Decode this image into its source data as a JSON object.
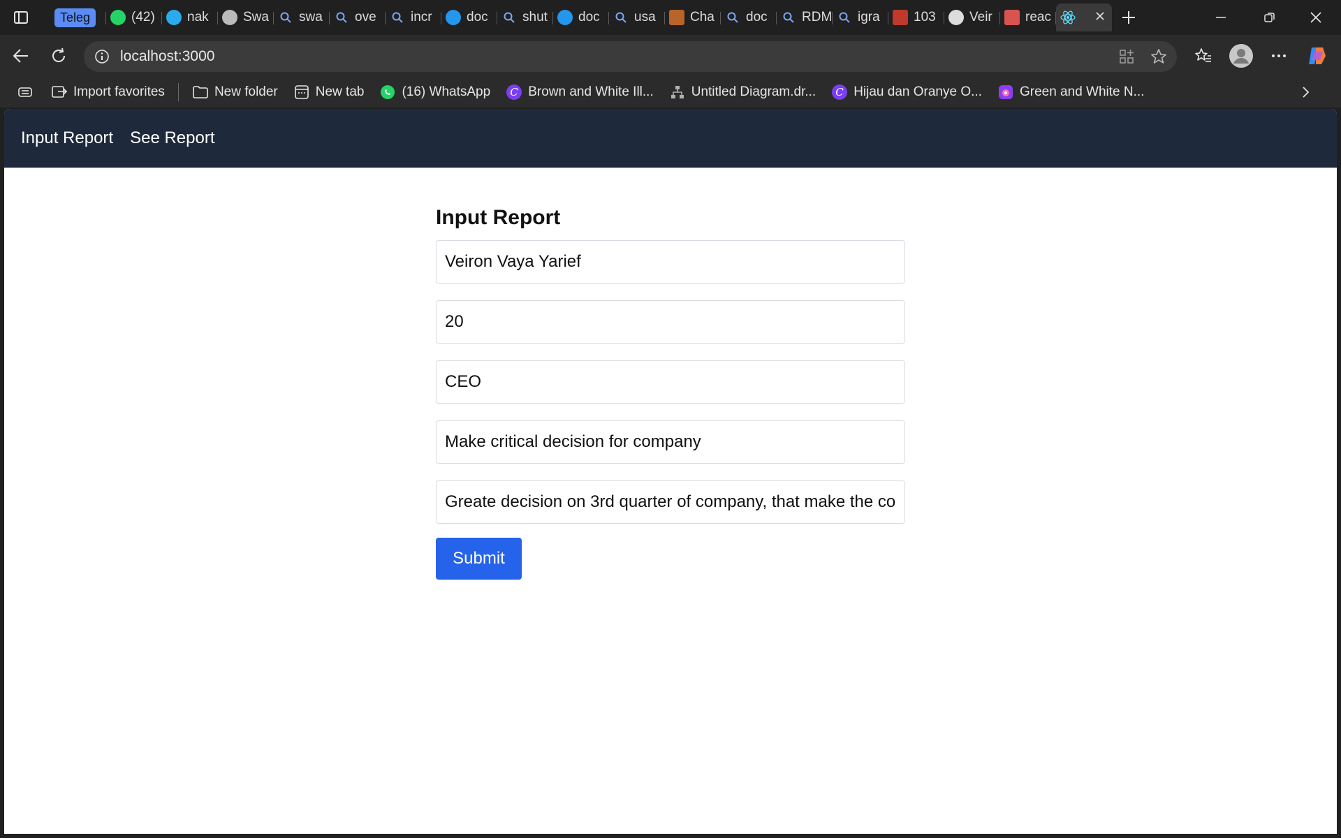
{
  "tabs": [
    {
      "title": "Teleg",
      "icon": "telegram-web-icon",
      "color": "#5b8cf5"
    },
    {
      "title": "(42)",
      "icon": "whatsapp-icon",
      "color": "#25d366"
    },
    {
      "title": "nak",
      "icon": "telegram-icon",
      "color": "#2aabee"
    },
    {
      "title": "Swa",
      "icon": "openai-icon",
      "color": "#bbbbbb"
    },
    {
      "title": "swa",
      "icon": "search-icon",
      "color": "#7aa7f7"
    },
    {
      "title": "ove",
      "icon": "search-icon",
      "color": "#7aa7f7"
    },
    {
      "title": "incr",
      "icon": "search-icon",
      "color": "#7aa7f7"
    },
    {
      "title": "doc",
      "icon": "docker-icon",
      "color": "#2496ed"
    },
    {
      "title": "shut",
      "icon": "search-icon",
      "color": "#7aa7f7"
    },
    {
      "title": "doc",
      "icon": "docker-icon",
      "color": "#2496ed"
    },
    {
      "title": "usa",
      "icon": "search-icon",
      "color": "#7aa7f7"
    },
    {
      "title": "Cha",
      "icon": "diagram-icon",
      "color": "#b8642a"
    },
    {
      "title": "doc",
      "icon": "search-icon",
      "color": "#7aa7f7"
    },
    {
      "title": "RDM",
      "icon": "search-icon",
      "color": "#7aa7f7"
    },
    {
      "title": "igra",
      "icon": "search-icon",
      "color": "#7aa7f7"
    },
    {
      "title": "103",
      "icon": "laravel-icon",
      "color": "#c0392b"
    },
    {
      "title": "Veir",
      "icon": "github-icon",
      "color": "#dddddd"
    },
    {
      "title": "reac",
      "icon": "pdf-icon",
      "color": "#d9534f"
    },
    {
      "title": "",
      "icon": "react-icon",
      "color": "#61dafb"
    }
  ],
  "address_bar": {
    "url": "localhost:3000"
  },
  "bookmarks": [
    {
      "label": "Import favorites",
      "icon": "import-icon"
    },
    {
      "label": "New folder",
      "icon": "folder-icon"
    },
    {
      "label": "New tab",
      "icon": "newtab-icon"
    },
    {
      "label": "(16) WhatsApp",
      "icon": "whatsapp-icon"
    },
    {
      "label": "Brown and White Ill...",
      "icon": "canva-icon"
    },
    {
      "label": "Untitled Diagram.dr...",
      "icon": "diagram-icon"
    },
    {
      "label": "Hijau dan Oranye O...",
      "icon": "canva-icon"
    },
    {
      "label": "Green and White N...",
      "icon": "canva-app-icon"
    }
  ],
  "app": {
    "nav": {
      "input_report": "Input Report",
      "see_report": "See Report"
    },
    "form": {
      "title": "Input Report",
      "fields": [
        {
          "value": "Veiron Vaya Yarief"
        },
        {
          "value": "20"
        },
        {
          "value": "CEO"
        },
        {
          "value": "Make critical decision for company"
        },
        {
          "value": "Greate decision on 3rd quarter of company, that make the co"
        }
      ],
      "submit_label": "Submit"
    }
  },
  "colors": {
    "nav_bg": "#1e293b",
    "submit_bg": "#2563eb",
    "chrome_bg": "#202020"
  }
}
